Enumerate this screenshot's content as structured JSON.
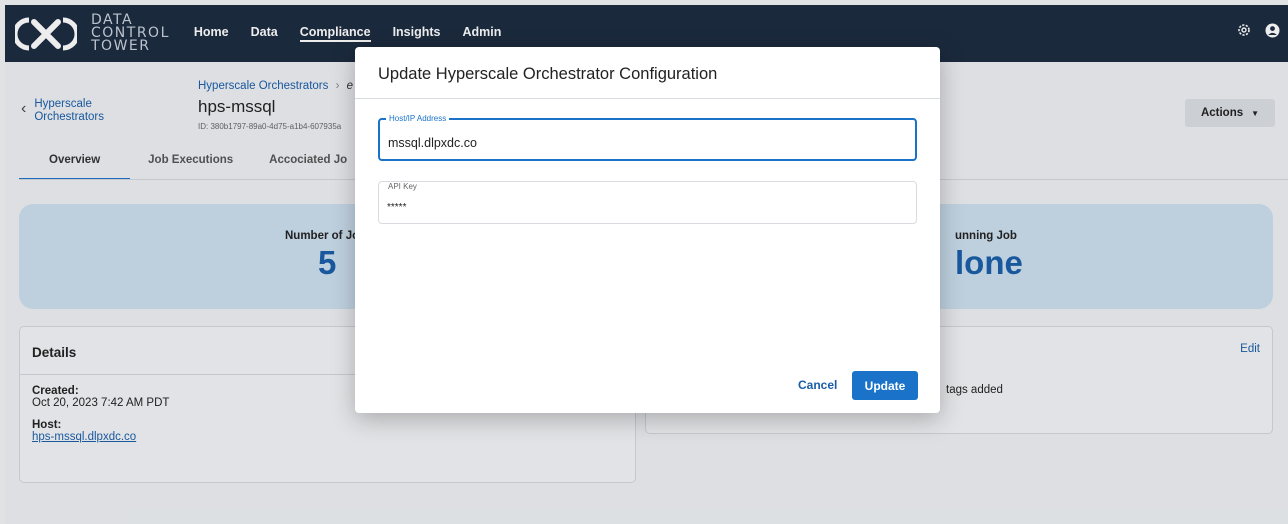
{
  "brand": {
    "line1": "DATA",
    "line2": "CONTROL",
    "line3": "TOWER",
    "color": "#1c2b3e"
  },
  "nav": {
    "items": [
      "Home",
      "Data",
      "Compliance",
      "Insights",
      "Admin"
    ],
    "active": "Compliance"
  },
  "top_icons": [
    "settings-icon",
    "user-icon"
  ],
  "back": {
    "line1": "Hyperscale",
    "line2": "Orchestrators"
  },
  "breadcrumb": {
    "parent": "Hyperscale Orchestrators",
    "separator": "›",
    "current": "e"
  },
  "page": {
    "title": "hps-mssql",
    "id_text": "ID: 380b1797-89a0-4d75-a1b4-607935a",
    "actions_label": "Actions"
  },
  "tabs": [
    "Overview",
    "Job Executions",
    "Accociated Jo"
  ],
  "stats": {
    "left_label": "Number of Jo",
    "left_value": "5",
    "right_label": "unning Job",
    "right_value": "lone"
  },
  "details": {
    "heading": "Details",
    "created_label": "Created:",
    "created_value": "Oct 20, 2023 7:42 AM PDT",
    "host_label": "Host:",
    "host_value": "hps-mssql.dlpxdc.co"
  },
  "tags": {
    "edit_label": "Edit",
    "empty_text": "tags added"
  },
  "modal": {
    "title": "Update Hyperscale Orchestrator Configuration",
    "host_label": "Host/IP Address",
    "host_value": "mssql.dlpxdc.co",
    "api_label": "API Key",
    "api_value": "*****",
    "cancel_label": "Cancel",
    "update_label": "Update"
  },
  "colors": {
    "accent": "#1a73c8",
    "link": "#1a5ea8",
    "stats_bg": "#cde0ee"
  }
}
